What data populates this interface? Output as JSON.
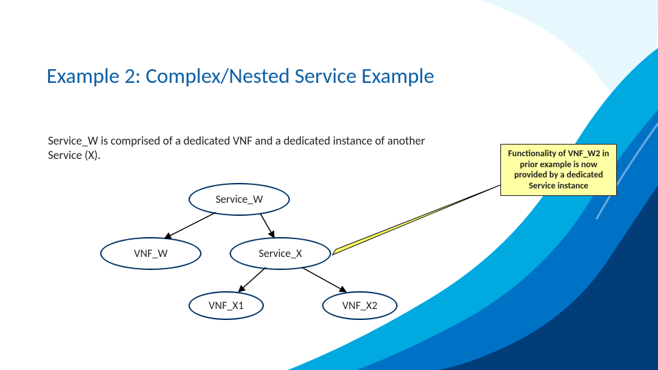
{
  "title": "Example 2: Complex/Nested Service Example",
  "description": "Service_W is comprised of a dedicated VNF and a dedicated instance of another Service (X).",
  "callout": "Functionality of VNF_W2 in prior example is now provided by a dedicated Service instance",
  "nodes": {
    "service_w": "Service_W",
    "vnf_w": "VNF_W",
    "service_x": "Service_X",
    "vnf_x1": "VNF_X1",
    "vnf_x2": "VNF_X2"
  },
  "colors": {
    "title": "#0b5fa5",
    "node_border": "#003366",
    "callout_bg": "#ffffa5",
    "wave1": "#00a9e0",
    "wave2": "#0072c6",
    "wave3": "#003d79"
  }
}
